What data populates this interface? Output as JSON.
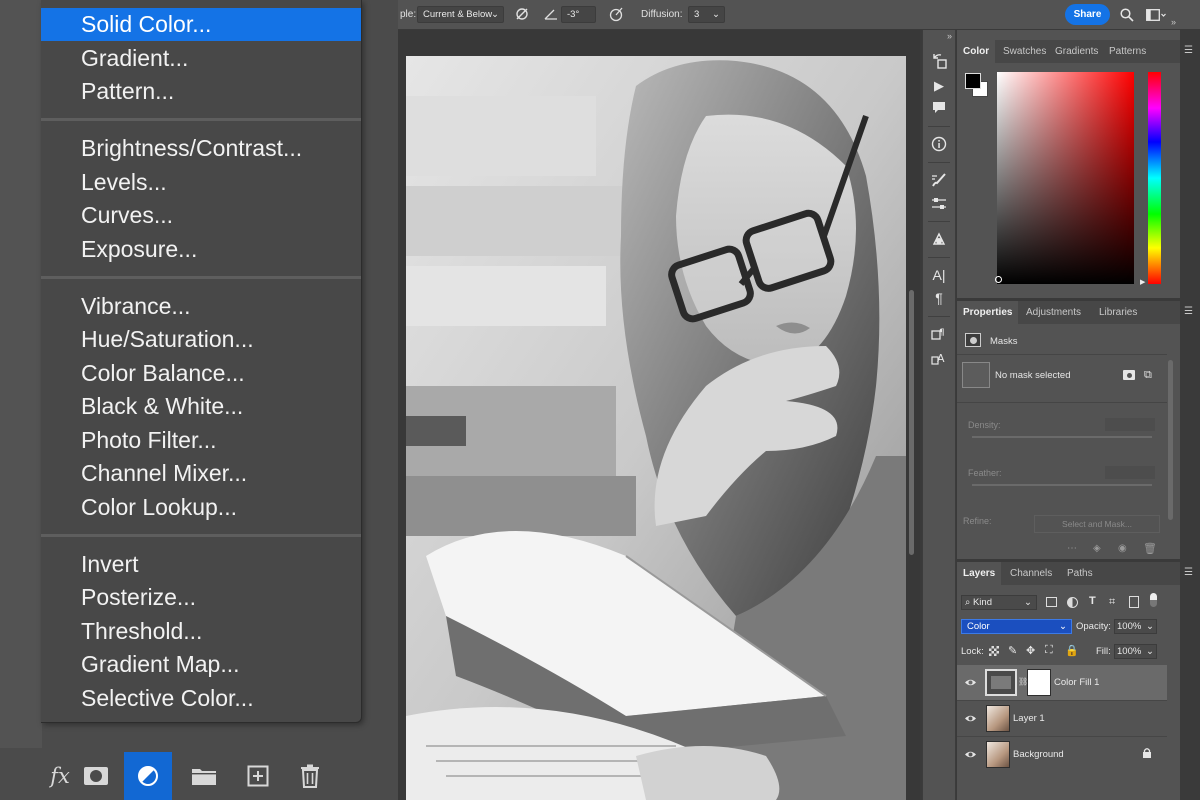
{
  "adjustment_menu": {
    "items": [
      "Solid Color...",
      "Gradient...",
      "Pattern...",
      "Brightness/Contrast...",
      "Levels...",
      "Curves...",
      "Exposure...",
      "Vibrance...",
      "Hue/Saturation...",
      "Color Balance...",
      "Black & White...",
      "Photo Filter...",
      "Channel Mixer...",
      "Color Lookup...",
      "Invert",
      "Posterize...",
      "Threshold...",
      "Gradient Map...",
      "Selective Color..."
    ],
    "selected": "Solid Color..."
  },
  "options_bar": {
    "sample_label": "ple:",
    "sample_value": "Current & Below",
    "angle_value": "-3°",
    "diffusion_label": "Diffusion:",
    "diffusion_value": "3",
    "share_label": "Share"
  },
  "color_panel": {
    "tabs": [
      "Color",
      "Swatches",
      "Gradients",
      "Patterns"
    ],
    "active_tab": "Color",
    "foreground": "#000000",
    "background": "#ffffff",
    "hue": "#ff0000"
  },
  "properties_panel": {
    "tabs": [
      "Properties",
      "Adjustments",
      "Libraries"
    ],
    "active_tab": "Properties",
    "section": "Masks",
    "mask_status": "No mask selected",
    "density_label": "Density:",
    "feather_label": "Feather:",
    "refine_label": "Refine:",
    "select_mask_label": "Select and Mask..."
  },
  "layers_panel": {
    "tabs": [
      "Layers",
      "Channels",
      "Paths"
    ],
    "active_tab": "Layers",
    "filter_label": "Kind",
    "blend_mode": "Color",
    "opacity_label": "Opacity:",
    "opacity_value": "100%",
    "lock_label": "Lock:",
    "fill_label": "Fill:",
    "fill_value": "100%",
    "layers": [
      {
        "name": "Color Fill 1",
        "selected": true
      },
      {
        "name": "Layer 1",
        "selected": false
      },
      {
        "name": "Background",
        "selected": false,
        "locked": true
      }
    ]
  },
  "colors": {
    "accent": "#1473e6",
    "panel": "#535353",
    "menu": "#484848"
  }
}
